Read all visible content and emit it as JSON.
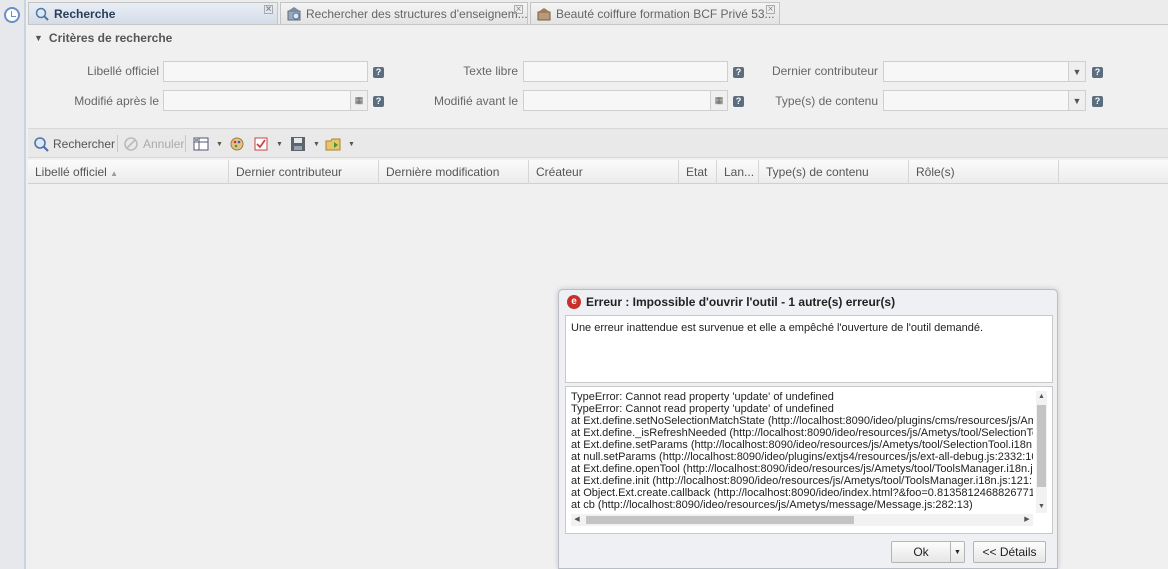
{
  "tabs": [
    {
      "label": "Recherche",
      "icon": "search-icon"
    },
    {
      "label": "Rechercher des structures d'enseignem...",
      "icon": "structure-icon"
    },
    {
      "label": "Beauté coiffure formation BCF Privé 53...",
      "icon": "content-icon"
    }
  ],
  "criteria": {
    "title": "Critères de recherche",
    "fields": {
      "libelle": {
        "label": "Libellé officiel",
        "value": ""
      },
      "texte_libre": {
        "label": "Texte libre",
        "value": ""
      },
      "dernier_contributeur": {
        "label": "Dernier contributeur",
        "value": ""
      },
      "modifie_apres": {
        "label": "Modifié après le",
        "value": ""
      },
      "modifie_avant": {
        "label": "Modifié avant le",
        "value": ""
      },
      "types_contenu": {
        "label": "Type(s) de contenu",
        "value": ""
      }
    },
    "help_symbol": "?"
  },
  "toolbar": {
    "search_label": "Rechercher",
    "cancel_label": "Annuler"
  },
  "grid": {
    "columns": [
      "Libellé officiel",
      "Dernier contributeur",
      "Dernière modification",
      "Créateur",
      "Etat",
      "Lan...",
      "Type(s) de contenu",
      "Rôle(s)"
    ],
    "sort_indicator": "▲"
  },
  "dialog": {
    "title": "Erreur : Impossible d'ouvrir l'outil - 1 autre(s) erreur(s)",
    "message": "Une erreur inattendue est survenue et elle a empêché l'ouverture de l'outil demandé.",
    "details": [
      "TypeError: Cannot read property 'update' of undefined",
      "TypeError: Cannot read property 'update' of undefined",
      "at Ext.define.setNoSelectionMatchState (http://localhost:8090/ideo/plugins/cms/resources/js/Am",
      "at Ext.define._isRefreshNeeded (http://localhost:8090/ideo/resources/js/Ametys/tool/SelectionTo",
      "at Ext.define.setParams (http://localhost:8090/ideo/resources/js/Ametys/tool/SelectionTool.i18n.",
      "at null.setParams (http://localhost:8090/ideo/plugins/extjs4/resources/js/ext-all-debug.js:2332:10",
      "at Ext.define.openTool (http://localhost:8090/ideo/resources/js/Ametys/tool/ToolsManager.i18n.j",
      "at Ext.define.init (http://localhost:8090/ideo/resources/js/Ametys/tool/ToolsManager.i18n.js:121:",
      "at Object.Ext.create.callback (http://localhost:8090/ideo/index.html?&foo=0.8135812468826771:",
      "at cb (http://localhost:8090/ideo/resources/js/Ametys/message/Message.js:282:13)"
    ],
    "ok_label": "Ok",
    "details_label": "<< Détails"
  }
}
